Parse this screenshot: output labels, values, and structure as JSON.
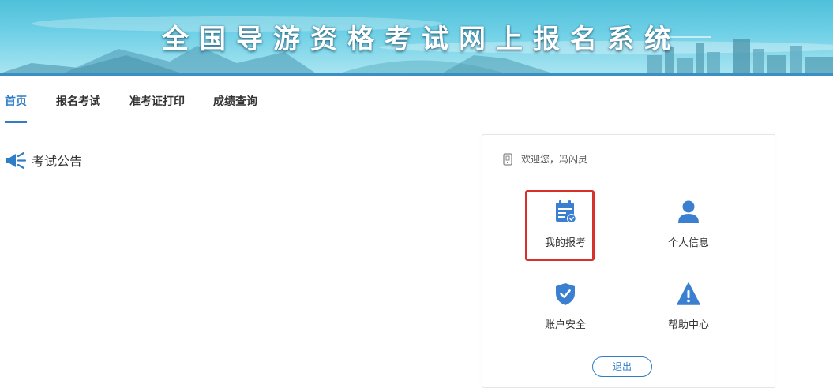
{
  "banner": {
    "title": "全国导游资格考试网上报名系统"
  },
  "nav": {
    "items": [
      {
        "label": "首页",
        "active": true
      },
      {
        "label": "报名考试",
        "active": false
      },
      {
        "label": "准考证打印",
        "active": false
      },
      {
        "label": "成绩查询",
        "active": false
      }
    ]
  },
  "announcement": {
    "icon": "megaphone-icon",
    "title": "考试公告"
  },
  "user_panel": {
    "welcome": "欢迎您，冯闪灵",
    "tiles": [
      {
        "label": "我的报考",
        "icon": "calendar-check-icon",
        "highlighted": true
      },
      {
        "label": "个人信息",
        "icon": "user-icon",
        "highlighted": false
      },
      {
        "label": "账户安全",
        "icon": "shield-check-icon",
        "highlighted": false
      },
      {
        "label": "帮助中心",
        "icon": "warning-triangle-icon",
        "highlighted": false
      }
    ],
    "logout_label": "退出"
  },
  "colors": {
    "accent": "#2f7ec5",
    "icon_blue": "#3b7fd1",
    "highlight_red": "#d8312b",
    "banner_top": "#4fc0da"
  }
}
